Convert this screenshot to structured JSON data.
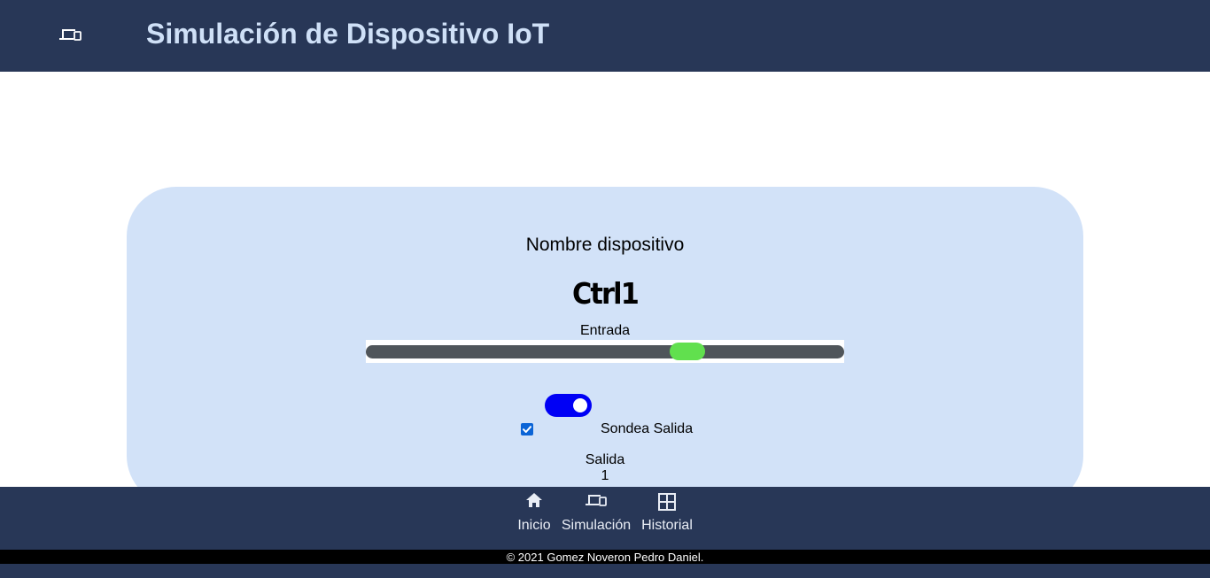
{
  "header": {
    "title": "Simulación de Dispositivo IoT",
    "menu_icon": "devices-icon"
  },
  "device": {
    "label": "Nombre dispositivo",
    "name": "Ctrl1"
  },
  "input": {
    "label": "Entrada",
    "value_fraction": 0.685
  },
  "toggle": {
    "on": true
  },
  "poll_output": {
    "checked": true,
    "label": "Sondea Salida"
  },
  "output": {
    "label": "Salida",
    "value": "1"
  },
  "nav": {
    "items": [
      {
        "label": "Inicio",
        "icon": "home-icon"
      },
      {
        "label": "Simulación",
        "icon": "devices-icon"
      },
      {
        "label": "Historial",
        "icon": "dashboard-icon"
      }
    ]
  },
  "footer": {
    "copyright": "© 2021 Gomez Noveron Pedro Daniel."
  },
  "colors": {
    "header_bg": "#283757",
    "title": "#cfe0f7",
    "card_bg": "#d2e2f8",
    "slider_track": "#4f555a",
    "slider_thumb": "#61e04e",
    "toggle_on": "#0000f5",
    "checkbox": "#0b64d6",
    "copyright_bg": "#000000"
  }
}
